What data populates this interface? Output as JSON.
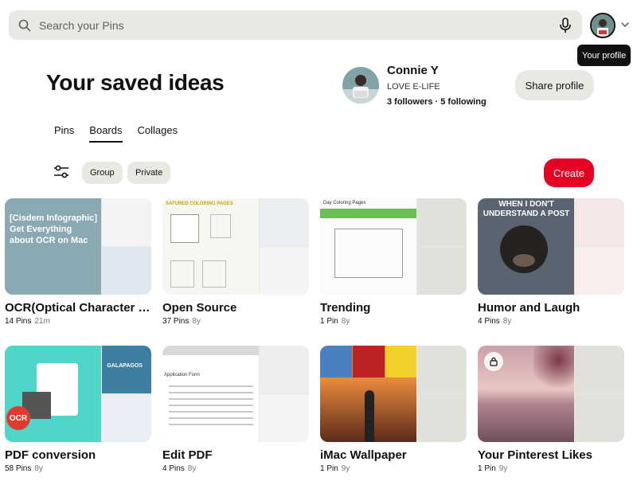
{
  "search": {
    "placeholder": "Search your Pins"
  },
  "tooltip": {
    "text": "Your profile"
  },
  "header": {
    "title": "Your saved ideas"
  },
  "profile": {
    "name": "Connie Y",
    "tagline": "LOVE E-LIFE",
    "follow": "3 followers · 5 following",
    "share_label": "Share profile"
  },
  "tabs": [
    {
      "label": "Pins"
    },
    {
      "label": "Boards",
      "active": true
    },
    {
      "label": "Collages"
    }
  ],
  "filters": {
    "group": "Group",
    "private": "Private",
    "create": "Create"
  },
  "boards": [
    {
      "title": "OCR(Optical Character Recognition)",
      "pins": "14 Pins",
      "age": "21m",
      "cover_text": "[Cisdem Infographic] Get Everything about OCR on Mac"
    },
    {
      "title": "Open Source",
      "pins": "37 Pins",
      "age": "8y",
      "cover_text": "SATURED COLORING PAGES"
    },
    {
      "title": "Trending",
      "pins": "1 Pin",
      "age": "8y",
      "cover_text": "Day Coloring Pages"
    },
    {
      "title": "Humor and Laugh",
      "pins": "4 Pins",
      "age": "8y",
      "cover_text": "WHEN I DON'T UNDERSTAND A POST"
    },
    {
      "title": "PDF conversion",
      "pins": "58 Pins",
      "age": "8y",
      "cover_text": "OCR",
      "side_text": "GALAPAGOS"
    },
    {
      "title": "Edit PDF",
      "pins": "4 Pins",
      "age": "8y",
      "cover_text": "Application Form"
    },
    {
      "title": "iMac Wallpaper",
      "pins": "1 Pin",
      "age": "9y"
    },
    {
      "title": "Your Pinterest Likes",
      "pins": "1 Pin",
      "age": "9y"
    }
  ],
  "colors": {
    "accent": "#e60023",
    "surface": "#e9e9e4"
  }
}
